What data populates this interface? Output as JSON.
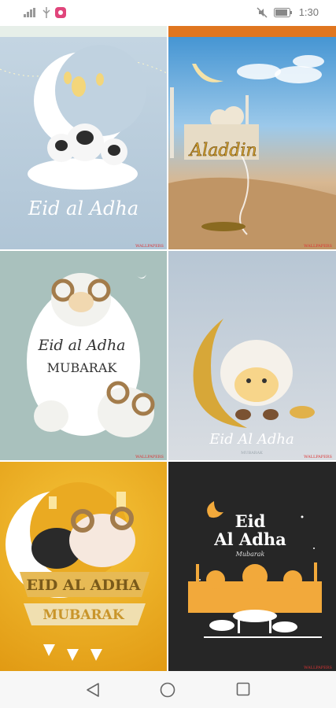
{
  "status_bar": {
    "time": "1:30",
    "left_icons": [
      "signal-icon",
      "usb-icon",
      "app-notification-icon"
    ],
    "right_icons": [
      "mute-icon",
      "battery-icon"
    ]
  },
  "wallpapers": [
    {
      "title": "Eid al Adha",
      "subtitle": ""
    },
    {
      "title": "Aladdin",
      "subtitle": ""
    },
    {
      "title": "Eid al Adha",
      "subtitle": "MUBARAK"
    },
    {
      "title": "Eid Al Adha",
      "subtitle": "MUBARAK"
    },
    {
      "title": "EID AL ADHA",
      "subtitle": "MUBARAK"
    },
    {
      "title": "Eid",
      "title2": "Al Adha",
      "subtitle": "Mubarak"
    }
  ],
  "navbar": {
    "back": "back-icon",
    "home": "home-icon",
    "recents": "recents-icon"
  },
  "colors": {
    "accent_gold": "#f0b020",
    "dark_tile": "#262626"
  }
}
